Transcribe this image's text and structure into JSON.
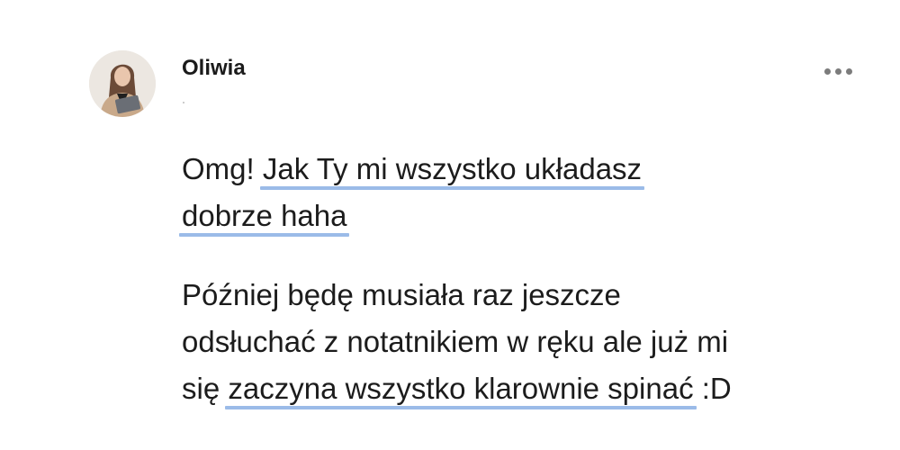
{
  "post": {
    "author": "Oliwia",
    "avatar_icon": "user-photo",
    "more_icon": "more-dots-icon"
  },
  "message": {
    "paragraph1": {
      "line1_plain": "Omg! ",
      "line1_highlight": "Jak Ty mi wszystko układasz",
      "line2_highlight": "dobrze haha"
    },
    "paragraph2": {
      "line1": "Później będę musiała raz jeszcze",
      "line2": "odsłuchać z notatnikiem w ręku ale już mi",
      "line3_plain": "się ",
      "line3_highlight": "zaczyna wszystko klarownie spinać",
      "line3_tail": " :D"
    }
  },
  "colors": {
    "highlight_underline": "#9bbbe8",
    "text": "#1c1c1c",
    "dots": "#7c7c7c"
  }
}
